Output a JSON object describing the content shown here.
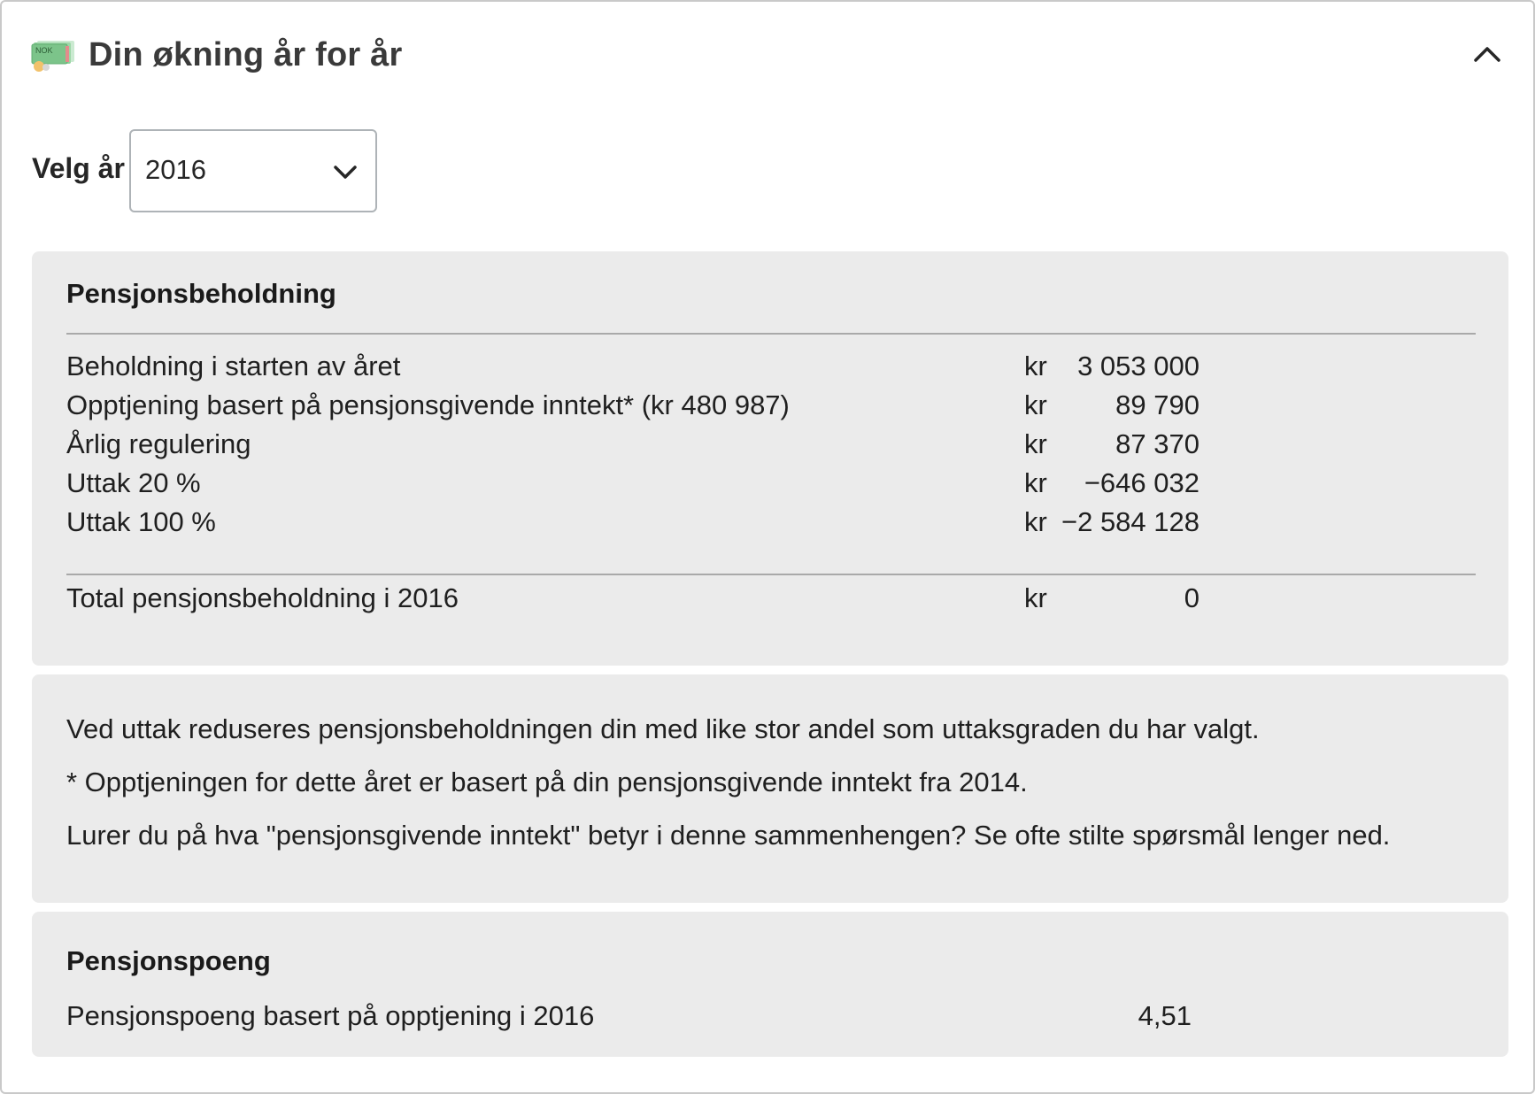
{
  "header": {
    "title": "Din økning år for år",
    "icon": "nok-money-icon",
    "icon_text": "NOK",
    "collapse_icon": "chevron-up-icon"
  },
  "year_select": {
    "label": "Velg år",
    "value": "2016",
    "icon": "chevron-down-icon"
  },
  "beholdning": {
    "heading": "Pensjonsbeholdning",
    "rows": [
      {
        "label": "Beholdning i starten av året",
        "currency": "kr",
        "amount": "3 053 000"
      },
      {
        "label": "Opptjening basert på pensjonsgivende inntekt* (kr 480 987)",
        "currency": "kr",
        "amount": "89 790"
      },
      {
        "label": "Årlig regulering",
        "currency": "kr",
        "amount": "87 370"
      },
      {
        "label": "Uttak 20 %",
        "currency": "kr",
        "amount": "−646 032"
      },
      {
        "label": "Uttak 100 %",
        "currency": "kr",
        "amount": "−2 584 128"
      }
    ],
    "total": {
      "label": "Total pensjonsbeholdning i 2016",
      "currency": "kr",
      "amount": "0"
    }
  },
  "info": {
    "lines": [
      "Ved uttak reduseres pensjonsbeholdningen din med like stor andel som uttaksgraden du har valgt.",
      "* Opptjeningen for dette året er basert på din pensjonsgivende inntekt fra 2014.",
      "Lurer du på hva \"pensjonsgivende inntekt\" betyr i denne sammenhengen? Se ofte stilte spørsmål lenger ned."
    ]
  },
  "poeng": {
    "heading": "Pensjonspoeng",
    "label": "Pensjonspoeng basert på opptjening i 2016",
    "value": "4,51"
  },
  "colors": {
    "card_background": "#ebebeb",
    "border": "#c9c9c9",
    "text": "#1f1f1f"
  }
}
